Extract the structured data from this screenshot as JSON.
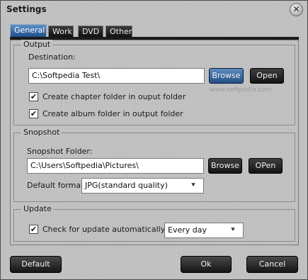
{
  "window": {
    "title": "Settings",
    "close_glyph": "✕"
  },
  "tabs": [
    {
      "label": "General"
    },
    {
      "label": "Work"
    },
    {
      "label": "DVD"
    },
    {
      "label": "Other"
    }
  ],
  "output": {
    "legend": "Output",
    "destination_label": "Destination:",
    "destination_value": "C:\\Softpedia Test\\",
    "browse_label": "Browse",
    "open_label": "Open",
    "chapter_folder_label": "Create chapter folder in ouput folder",
    "chapter_folder_checked": true,
    "album_folder_label": "Create album folder in output folder",
    "album_folder_checked": true
  },
  "snapshot": {
    "legend": "Snopshot",
    "folder_label": "Snopshot Folder:",
    "folder_value": "C:\\Users\\Softpedia\\Pictures\\",
    "browse_label": "Browse",
    "open_label": "OPen",
    "format_label": "Default format:",
    "format_value": "JPG(standard quality)"
  },
  "update": {
    "legend": "Update",
    "check_label": "Check for update automatically",
    "check_checked": true,
    "frequency_value": "Every day"
  },
  "footer": {
    "default_label": "Default",
    "ok_label": "Ok",
    "cancel_label": "Cancel"
  },
  "watermark": {
    "text": "www.softpedia.com"
  },
  "icons": {
    "check": "✔",
    "dropdown": "⯆"
  },
  "colors": {
    "accent": "#2e5e96",
    "button_dark": "#1a1a1a"
  }
}
